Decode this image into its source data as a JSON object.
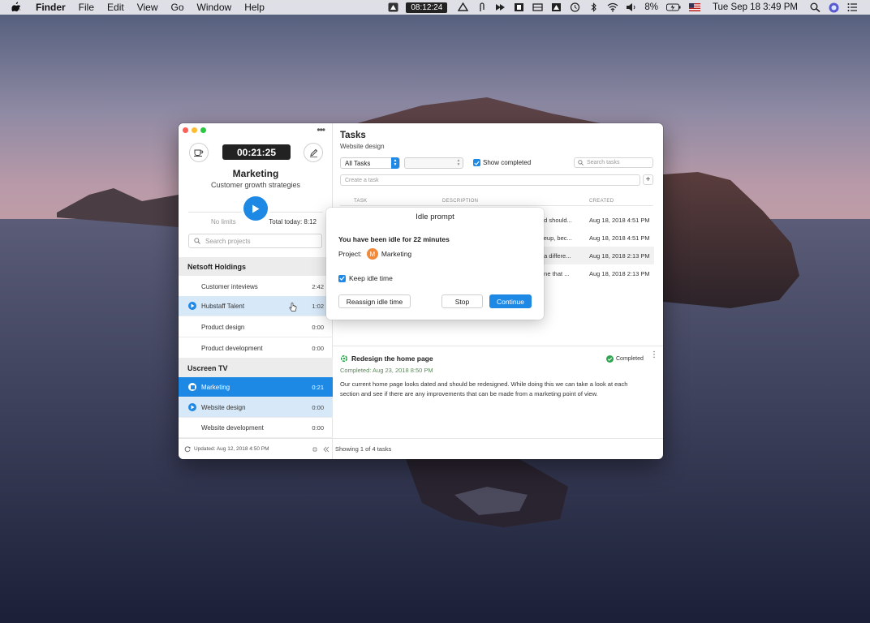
{
  "menubar": {
    "app_name": "Finder",
    "menus": [
      "File",
      "Edit",
      "View",
      "Go",
      "Window",
      "Help"
    ],
    "timer": "08:12:24",
    "battery": "8%",
    "datetime": "Tue Sep 18  3:49 PM"
  },
  "sidebar": {
    "timer": "00:21:25",
    "project_name": "Marketing",
    "project_subtitle": "Customer growth strategies",
    "no_limits": "No limits",
    "total_today": "Total today: 8:12",
    "search_placeholder": "Search projects",
    "groups": [
      {
        "name": "Netsoft Holdings",
        "items": [
          {
            "label": "Customer inteviews",
            "time": "2:42"
          },
          {
            "label": "Hubstaff Talent",
            "time": "1:02"
          },
          {
            "label": "Product design",
            "time": "0:00"
          },
          {
            "label": "Product development",
            "time": "0:00"
          }
        ]
      },
      {
        "name": "Uscreen TV",
        "items": [
          {
            "label": "Marketing",
            "time": "0:21"
          },
          {
            "label": "Website design",
            "time": "0:00"
          },
          {
            "label": "Website development",
            "time": "0:00"
          }
        ]
      }
    ],
    "updated": "Updated: Aug 12, 2018 4:50 PM"
  },
  "main": {
    "title": "Tasks",
    "subtitle": "Website design",
    "filter_value": "All Tasks",
    "show_completed": "Show completed",
    "search_placeholder": "Search tasks",
    "create_placeholder": "Create a task",
    "columns": [
      "TASK",
      "DESCRIPTION",
      "CREATED"
    ],
    "rows": [
      {
        "description": "ed should...",
        "created": "Aug 18, 2018 4:51 PM"
      },
      {
        "description": "keup, bec...",
        "created": "Aug 18, 2018 4:51 PM"
      },
      {
        "description": "t a differe...",
        "created": "Aug 18, 2018 2:13 PM"
      },
      {
        "description": "one that ...",
        "created": "Aug 18, 2018 2:13 PM"
      }
    ],
    "detail": {
      "title": "Redesign the home page",
      "status": "Completed",
      "completed_date": "Completed: Aug 23, 2018 8:50 PM",
      "description": "Our current home page looks dated and should be redesigned. While doing this we can take a look at each section and see if there are any improvements that can be made from a marketing point of view."
    },
    "footer": "Showing 1 of 4 tasks"
  },
  "modal": {
    "title": "Idle prompt",
    "message": "You have been idle for 22 minutes",
    "project_label": "Project:",
    "avatar_letter": "M",
    "project_name": "Marketing",
    "keep_idle": "Keep idle time",
    "btn_reassign": "Reassign idle time",
    "btn_stop": "Stop",
    "btn_continue": "Continue"
  },
  "colors": {
    "accent": "#1e88e5",
    "avatar": "#f08a3a",
    "completed": "#2fa44f"
  }
}
